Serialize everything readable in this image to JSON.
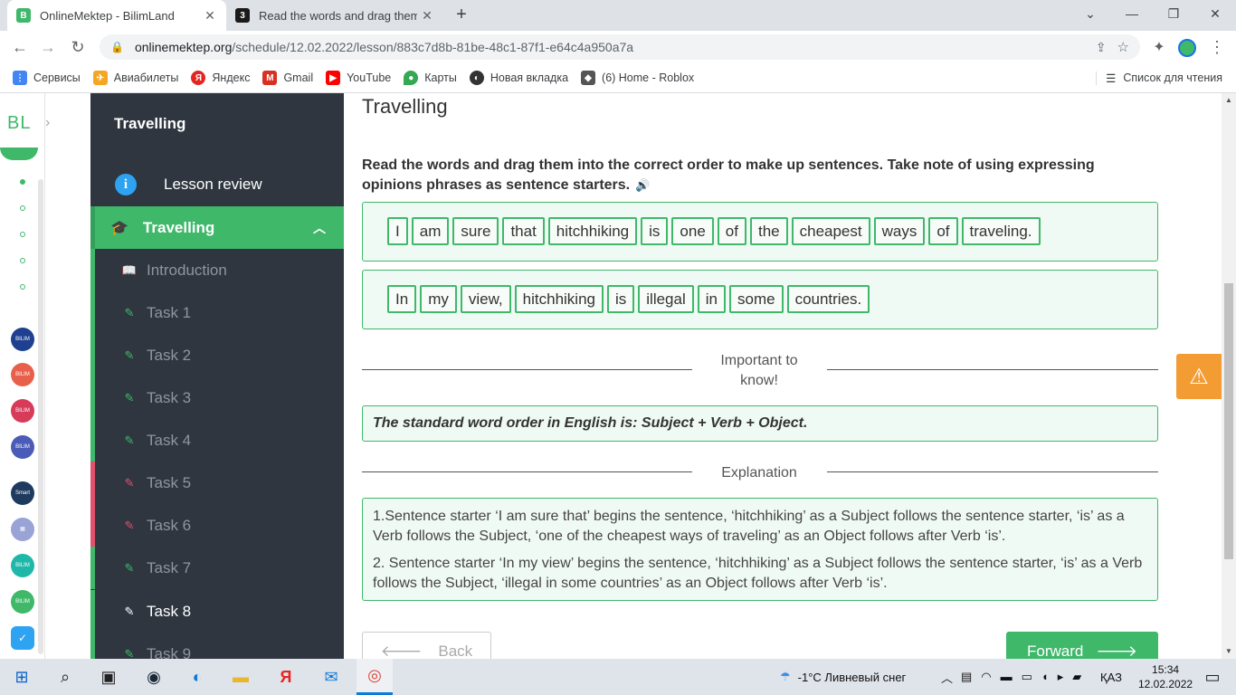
{
  "browser": {
    "tabs": [
      {
        "title": "OnlineMektep - BilimLand",
        "favicon": "B",
        "color": "#3fb86a"
      },
      {
        "title": "Read the words and drag them in",
        "favicon": "3",
        "color": "#1a1a1a"
      }
    ],
    "new_tab_icon": "+",
    "url_host": "onlinemektep.org",
    "url_path": "/schedule/12.02.2022/lesson/883c7d8b-81be-48c1-87f1-e64c4a950a7a",
    "bookmarks": [
      {
        "label": "Сервисы",
        "icon": "apps-icon",
        "color": "#4285f4"
      },
      {
        "label": "Авиабилеты",
        "icon": "plane-icon",
        "color": "#f5a623"
      },
      {
        "label": "Яндекс",
        "icon": "yandex-icon",
        "color": "#e52620"
      },
      {
        "label": "Gmail",
        "icon": "gmail-icon",
        "color": "#d93025"
      },
      {
        "label": "YouTube",
        "icon": "youtube-icon",
        "color": "#ff0000"
      },
      {
        "label": "Карты",
        "icon": "maps-icon",
        "color": "#34a853"
      },
      {
        "label": "Новая вкладка",
        "icon": "globe-icon",
        "color": "#333333"
      },
      {
        "label": "(6) Home - Roblox",
        "icon": "roblox-icon",
        "color": "#555555"
      }
    ],
    "reading_list": "Список для чтения"
  },
  "rail": {
    "logo": "BL"
  },
  "sidebar": {
    "title": "Travelling",
    "review": "Lesson review",
    "module": "Travelling",
    "items": [
      {
        "label": "Introduction",
        "status": "green"
      },
      {
        "label": "Task 1",
        "status": "green"
      },
      {
        "label": "Task 2",
        "status": "green"
      },
      {
        "label": "Task 3",
        "status": "green"
      },
      {
        "label": "Task 4",
        "status": "green"
      },
      {
        "label": "Task 5",
        "status": "red"
      },
      {
        "label": "Task 6",
        "status": "red"
      },
      {
        "label": "Task 7",
        "status": "green"
      },
      {
        "label": "Task 8",
        "status": "current"
      },
      {
        "label": "Task 9",
        "status": "green"
      }
    ]
  },
  "main": {
    "lesson_title": "Travelling",
    "instructions": "Read the words and drag them into the correct order to make up sentences. Take note of using expressing opinions phrases as sentence starters.",
    "sentences": [
      [
        "I",
        "am",
        "sure",
        "that",
        "hitchhiking",
        "is",
        "one",
        "of",
        "the",
        "cheapest",
        "ways",
        "of",
        "traveling."
      ],
      [
        "In",
        "my",
        "view,",
        "hitchhiking",
        "is",
        "illegal",
        "in",
        "some",
        "countries."
      ]
    ],
    "important_label": "Important to know!",
    "rule": "The standard word order in English is: Subject + Verb + Object.",
    "explanation_label": "Explanation",
    "explanation_1": "1.Sentence starter ‘I am sure that’ begins the sentence, ‘hitchhiking’ as a Subject follows the sentence starter, ‘is’ as a Verb follows the Subject, ‘one of the cheapest ways of traveling’ as an Object follows after Verb ‘is’.",
    "explanation_2": "2. Sentence starter ‘In my view’ begins the sentence, ‘hitchhiking’ as a Subject follows the sentence starter, ‘is’ as a Verb follows the Subject, ‘illegal in some countries’ as an Object follows after Verb ‘is’.",
    "back": "Back",
    "forward": "Forward"
  },
  "taskbar": {
    "weather": "-1°C  Ливневый снег",
    "lang": "ҚАЗ",
    "time": "15:34",
    "date": "12.02.2022"
  }
}
